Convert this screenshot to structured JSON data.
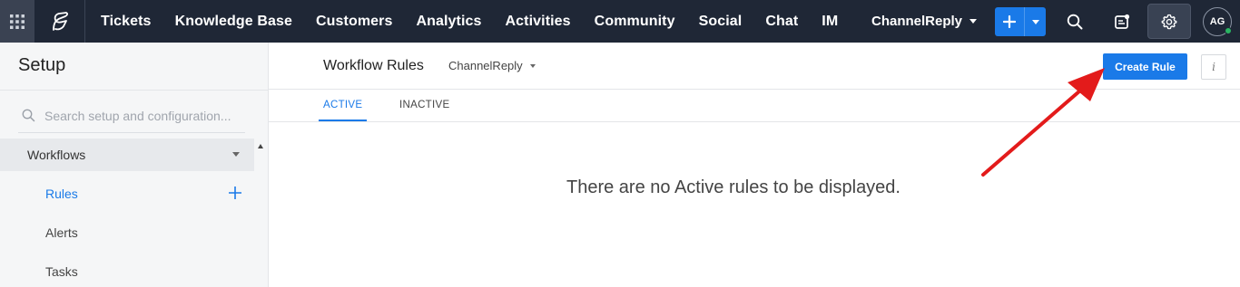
{
  "topbar": {
    "nav": [
      "Tickets",
      "Knowledge Base",
      "Customers",
      "Analytics",
      "Activities",
      "Community",
      "Social",
      "Chat",
      "IM"
    ],
    "brand": "ChannelReply",
    "avatar": "AG",
    "accent": "#1a7ae8",
    "icons": [
      "apps-grid-icon",
      "desk-logo-icon",
      "search-icon",
      "notes-icon",
      "gear-icon"
    ]
  },
  "sidebar": {
    "title": "Setup",
    "search_placeholder": "Search setup and configuration...",
    "section": "Workflows",
    "items": [
      "Rules",
      "Alerts",
      "Tasks"
    ]
  },
  "main": {
    "title": "Workflow Rules",
    "brand": "ChannelReply",
    "create_label": "Create Rule",
    "info_label": "i",
    "tabs": [
      "ACTIVE",
      "INACTIVE"
    ],
    "empty_message": "There are no Active rules to be displayed."
  }
}
